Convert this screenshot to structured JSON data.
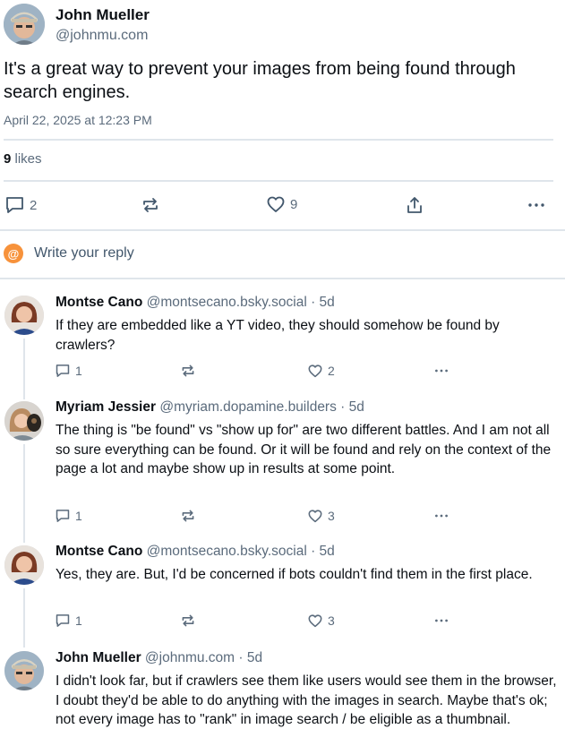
{
  "post": {
    "author_name": "John Mueller",
    "author_handle": "@johnmu.com",
    "text": "It's a great way to prevent your images from being found through search engines.",
    "date": "April 22, 2025 at 12:23 PM",
    "likes_count": "9",
    "likes_label": "likes",
    "actions": {
      "reply_count": "2",
      "like_count": "9"
    }
  },
  "composer": {
    "placeholder": "Write your reply",
    "avatar_glyph": "@"
  },
  "replies": [
    {
      "name": "Montse Cano",
      "handle": "@montsecano.bsky.social",
      "age": "· 5d",
      "text": "If they are embedded like a YT video, they should somehow be found by crawlers?",
      "reply_count": "1",
      "like_count": "2"
    },
    {
      "name": "Myriam Jessier",
      "handle": "@myriam.dopamine.builders",
      "age": "· 5d",
      "text": "The thing is \"be found\" vs \"show up for\" are two different battles. And I am not all so sure everything can be found. Or it will be found and rely on the context of the page a lot and maybe show up in results at some point.",
      "reply_count": "1",
      "like_count": "3"
    },
    {
      "name": "Montse Cano",
      "handle": "@montsecano.bsky.social",
      "age": "· 5d",
      "text": "Yes, they are. But, I'd be concerned if bots couldn't find them in the first place.",
      "reply_count": "1",
      "like_count": "3"
    },
    {
      "name": "John Mueller",
      "handle": "@johnmu.com",
      "age": "· 5d",
      "text": "I didn't look far, but if crawlers see them like users would see them in the browser, I doubt they'd be able to do anything with the images in search. Maybe that's ok;  not every image has to \"rank\" in image search / be eligible as a thumbnail."
    }
  ],
  "colors": {
    "text": "#0b0f14",
    "muted": "#5b6b7c",
    "divider": "#dfe5eb",
    "accent": "#1083fe",
    "composer_avatar": "#f7923b"
  }
}
